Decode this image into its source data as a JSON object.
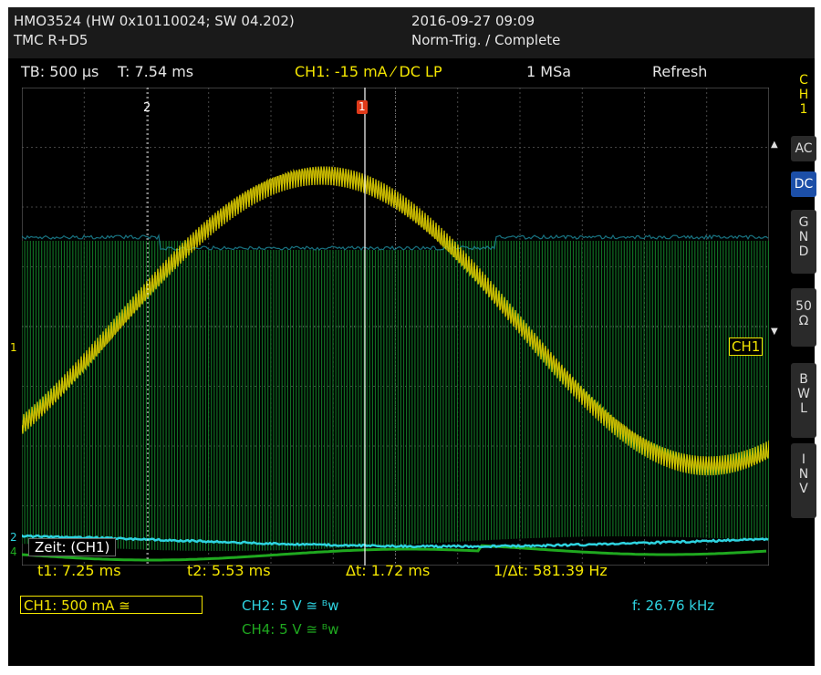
{
  "header": {
    "model": "HMO3524 (HW 0x10110024; SW 04.202)",
    "options": "TMC R+D5",
    "datetime": "2016-09-27 09:09",
    "trigger_mode": "Norm-Trig. / Complete"
  },
  "status": {
    "timebase": "TB: 500 µs",
    "trigger_time": "T: 7.54 ms",
    "trigger_source": "CH1: -15 mA ⁄ DC LP",
    "sample_rate": "1 MSa",
    "acquire_mode": "Refresh"
  },
  "side_menu": {
    "channel_label": "C\nH\n1",
    "buttons": [
      {
        "label": "AC",
        "active": false
      },
      {
        "label": "DC",
        "active": true
      },
      {
        "label": "G\nN\nD",
        "active": false
      },
      {
        "label": "50\nΩ",
        "active": false
      },
      {
        "label": "B\nW\nL",
        "active": false
      },
      {
        "label": "I\nN\nV",
        "active": false
      }
    ]
  },
  "markers": {
    "cursor2": "2",
    "trigger_marker": "1",
    "ch1_level_tag": "CH1",
    "ch1_left_marker": "1",
    "ch2_left_marker": "2",
    "ch4_left_marker": "4"
  },
  "cursor_readout": {
    "source": "Zeit: (CH1)",
    "t1": "t1: 7.25 ms",
    "t2": "t2: 5.53 ms",
    "dt": "Δt: 1.72 ms",
    "inv_dt": "1/Δt: 581.39 Hz"
  },
  "channels": {
    "ch1": "CH1: 500 mA ≅",
    "ch2": "CH2: 5 V ≅ ᴮᴡ",
    "ch4": "CH4: 5 V ≅ ᴮᴡ",
    "frequency": "f: 26.76 kHz"
  },
  "colors": {
    "ch1": "#f3e500",
    "ch2": "#2ed3e0",
    "ch4": "#1fa81f",
    "background": "#000000",
    "grid": "#5a5a5a",
    "active_button": "#1c4fa8"
  }
}
